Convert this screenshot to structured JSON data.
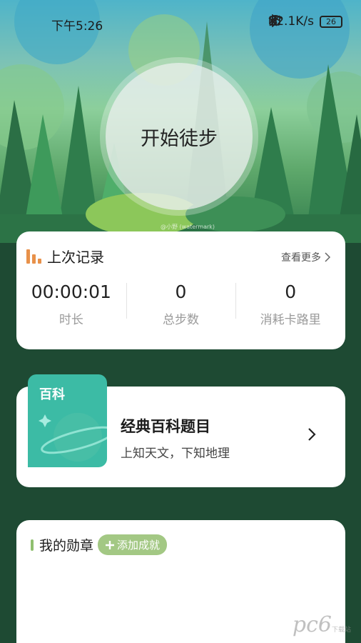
{
  "status_bar": {
    "time": "下午5:26",
    "network_speed": "12.1K/s",
    "battery": "26",
    "icons": [
      "bluetooth-icon",
      "mute-icon",
      "sim-off-icon",
      "wifi-icon",
      "battery-icon"
    ]
  },
  "hero": {
    "start_button": "开始徒步",
    "credit": "@小野 (watermark)"
  },
  "last_record": {
    "title": "上次记录",
    "more": "查看更多",
    "stats": [
      {
        "value": "00:00:01",
        "label": "时长"
      },
      {
        "value": "0",
        "label": "总步数"
      },
      {
        "value": "0",
        "label": "消耗卡路里"
      }
    ]
  },
  "wiki": {
    "tile_label": "百科",
    "title": "经典百科题目",
    "subtitle": "上知天文，下知地理"
  },
  "medals": {
    "title": "我的勋章",
    "add_button": "添加成就"
  },
  "watermark": {
    "text": "pc6",
    "small": "下载站"
  },
  "colors": {
    "page_bg": "#1e4a33",
    "accent_orange": "#e8914a",
    "wiki_teal": "#3cbba5",
    "medal_green": "#a3c884"
  }
}
